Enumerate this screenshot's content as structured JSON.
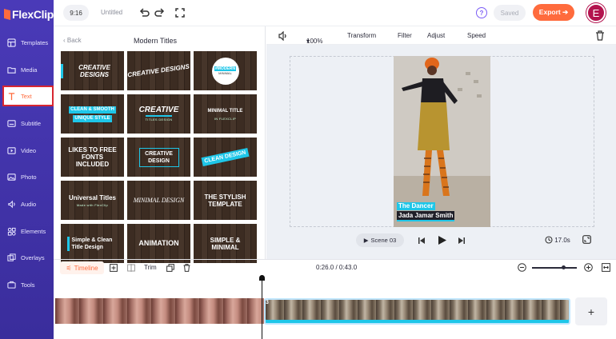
{
  "app": {
    "logo_text": "FlexClip"
  },
  "sidebar": {
    "items": [
      {
        "label": "Templates",
        "icon": "templates-icon"
      },
      {
        "label": "Media",
        "icon": "media-icon"
      },
      {
        "label": "Text",
        "icon": "text-icon"
      },
      {
        "label": "Subtitle",
        "icon": "subtitle-icon"
      },
      {
        "label": "Video",
        "icon": "video-icon"
      },
      {
        "label": "Photo",
        "icon": "photo-icon"
      },
      {
        "label": "Audio",
        "icon": "audio-icon"
      },
      {
        "label": "Elements",
        "icon": "elements-icon"
      },
      {
        "label": "Overlays",
        "icon": "overlays-icon"
      },
      {
        "label": "Tools",
        "icon": "tools-icon"
      }
    ],
    "active_item": "Text"
  },
  "topbar": {
    "aspect_ratio": "9:16",
    "doc_title": "Untitled",
    "saved_label": "Saved",
    "export_label": "Export ➔",
    "avatar_letter": "E"
  },
  "panel": {
    "back_label": "Back",
    "title": "Modern Titles",
    "templates": [
      {
        "line1": "CREATIVE DESIGNS",
        "line2": ""
      },
      {
        "line1": "CREATIVE DESIGNS",
        "line2": ""
      },
      {
        "line1": "#MODERN",
        "line2": "MINIMAL"
      },
      {
        "line1": "CLEAN & SMOOTH",
        "line2": "UNIQUE STYLE"
      },
      {
        "line1": "CREATIVE",
        "line2": "TITLES DESIGN"
      },
      {
        "line1": "MINIMAL TITLE",
        "line2": "IN FLEXCLIP"
      },
      {
        "line1": "LIKES TO FREE FONTS INCLUDED",
        "line2": ""
      },
      {
        "line1": "CREATIVE DESIGN",
        "line2": ""
      },
      {
        "line1": "CLEAN DESIGN",
        "line2": ""
      },
      {
        "line1": "Universal Titles",
        "line2": "Made with FlexClip"
      },
      {
        "line1": "MINIMAL DESIGN",
        "line2": ""
      },
      {
        "line1": "THE STYLISH TEMPLATE",
        "line2": ""
      },
      {
        "line1": "Simple & Clean Title Design",
        "line2": ""
      },
      {
        "line1": "ANIMATION",
        "line2": ""
      },
      {
        "line1": "SIMPLE & MINIMAL",
        "line2": ""
      }
    ]
  },
  "toolbar": {
    "zoom": "100%",
    "transform": "Transform",
    "filter": "Filter",
    "adjust": "Adjust",
    "speed": "Speed"
  },
  "preview": {
    "caption_line1": "The Dancer",
    "caption_line2": "Jada Jamar Smith",
    "scene_label": "Scene",
    "scene_number": "03",
    "duration": "17.0s"
  },
  "timeline": {
    "label": "Timeline",
    "trim_label": "Trim",
    "time_display": "0:26.0 / 0:43.0",
    "clip_number": "3",
    "zoom_level": 0.7
  }
}
